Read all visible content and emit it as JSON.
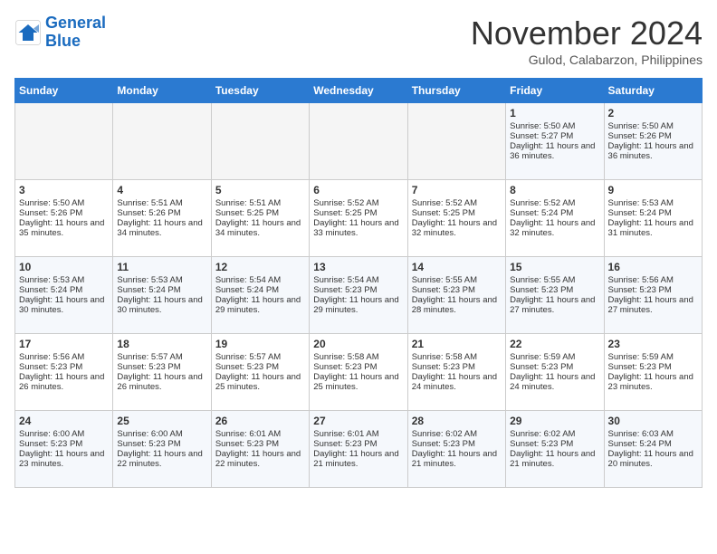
{
  "header": {
    "logo_line1": "General",
    "logo_line2": "Blue",
    "month": "November 2024",
    "location": "Gulod, Calabarzon, Philippines"
  },
  "weekdays": [
    "Sunday",
    "Monday",
    "Tuesday",
    "Wednesday",
    "Thursday",
    "Friday",
    "Saturday"
  ],
  "weeks": [
    [
      {
        "day": "",
        "empty": true
      },
      {
        "day": "",
        "empty": true
      },
      {
        "day": "",
        "empty": true
      },
      {
        "day": "",
        "empty": true
      },
      {
        "day": "",
        "empty": true
      },
      {
        "day": "1",
        "sunrise": "5:50 AM",
        "sunset": "5:27 PM",
        "daylight": "11 hours and 36 minutes."
      },
      {
        "day": "2",
        "sunrise": "5:50 AM",
        "sunset": "5:26 PM",
        "daylight": "11 hours and 36 minutes."
      }
    ],
    [
      {
        "day": "3",
        "sunrise": "5:50 AM",
        "sunset": "5:26 PM",
        "daylight": "11 hours and 35 minutes."
      },
      {
        "day": "4",
        "sunrise": "5:51 AM",
        "sunset": "5:26 PM",
        "daylight": "11 hours and 34 minutes."
      },
      {
        "day": "5",
        "sunrise": "5:51 AM",
        "sunset": "5:25 PM",
        "daylight": "11 hours and 34 minutes."
      },
      {
        "day": "6",
        "sunrise": "5:52 AM",
        "sunset": "5:25 PM",
        "daylight": "11 hours and 33 minutes."
      },
      {
        "day": "7",
        "sunrise": "5:52 AM",
        "sunset": "5:25 PM",
        "daylight": "11 hours and 32 minutes."
      },
      {
        "day": "8",
        "sunrise": "5:52 AM",
        "sunset": "5:24 PM",
        "daylight": "11 hours and 32 minutes."
      },
      {
        "day": "9",
        "sunrise": "5:53 AM",
        "sunset": "5:24 PM",
        "daylight": "11 hours and 31 minutes."
      }
    ],
    [
      {
        "day": "10",
        "sunrise": "5:53 AM",
        "sunset": "5:24 PM",
        "daylight": "11 hours and 30 minutes."
      },
      {
        "day": "11",
        "sunrise": "5:53 AM",
        "sunset": "5:24 PM",
        "daylight": "11 hours and 30 minutes."
      },
      {
        "day": "12",
        "sunrise": "5:54 AM",
        "sunset": "5:24 PM",
        "daylight": "11 hours and 29 minutes."
      },
      {
        "day": "13",
        "sunrise": "5:54 AM",
        "sunset": "5:23 PM",
        "daylight": "11 hours and 29 minutes."
      },
      {
        "day": "14",
        "sunrise": "5:55 AM",
        "sunset": "5:23 PM",
        "daylight": "11 hours and 28 minutes."
      },
      {
        "day": "15",
        "sunrise": "5:55 AM",
        "sunset": "5:23 PM",
        "daylight": "11 hours and 27 minutes."
      },
      {
        "day": "16",
        "sunrise": "5:56 AM",
        "sunset": "5:23 PM",
        "daylight": "11 hours and 27 minutes."
      }
    ],
    [
      {
        "day": "17",
        "sunrise": "5:56 AM",
        "sunset": "5:23 PM",
        "daylight": "11 hours and 26 minutes."
      },
      {
        "day": "18",
        "sunrise": "5:57 AM",
        "sunset": "5:23 PM",
        "daylight": "11 hours and 26 minutes."
      },
      {
        "day": "19",
        "sunrise": "5:57 AM",
        "sunset": "5:23 PM",
        "daylight": "11 hours and 25 minutes."
      },
      {
        "day": "20",
        "sunrise": "5:58 AM",
        "sunset": "5:23 PM",
        "daylight": "11 hours and 25 minutes."
      },
      {
        "day": "21",
        "sunrise": "5:58 AM",
        "sunset": "5:23 PM",
        "daylight": "11 hours and 24 minutes."
      },
      {
        "day": "22",
        "sunrise": "5:59 AM",
        "sunset": "5:23 PM",
        "daylight": "11 hours and 24 minutes."
      },
      {
        "day": "23",
        "sunrise": "5:59 AM",
        "sunset": "5:23 PM",
        "daylight": "11 hours and 23 minutes."
      }
    ],
    [
      {
        "day": "24",
        "sunrise": "6:00 AM",
        "sunset": "5:23 PM",
        "daylight": "11 hours and 23 minutes."
      },
      {
        "day": "25",
        "sunrise": "6:00 AM",
        "sunset": "5:23 PM",
        "daylight": "11 hours and 22 minutes."
      },
      {
        "day": "26",
        "sunrise": "6:01 AM",
        "sunset": "5:23 PM",
        "daylight": "11 hours and 22 minutes."
      },
      {
        "day": "27",
        "sunrise": "6:01 AM",
        "sunset": "5:23 PM",
        "daylight": "11 hours and 21 minutes."
      },
      {
        "day": "28",
        "sunrise": "6:02 AM",
        "sunset": "5:23 PM",
        "daylight": "11 hours and 21 minutes."
      },
      {
        "day": "29",
        "sunrise": "6:02 AM",
        "sunset": "5:23 PM",
        "daylight": "11 hours and 21 minutes."
      },
      {
        "day": "30",
        "sunrise": "6:03 AM",
        "sunset": "5:24 PM",
        "daylight": "11 hours and 20 minutes."
      }
    ]
  ]
}
